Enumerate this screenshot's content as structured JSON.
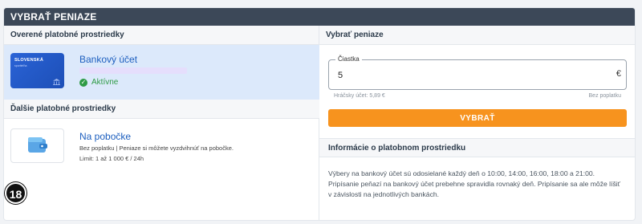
{
  "header": {
    "title": "VYBRAŤ PENIAZE"
  },
  "left": {
    "verified_title": "Overené platobné prostriedky",
    "bank_method": {
      "card_brand": "SLOVENSKÁ",
      "card_sub": "sporiteľňa",
      "title": "Bankový účet",
      "status": "Aktívne"
    },
    "other_title": "Ďalšie platobné prostriedky",
    "branch_method": {
      "title": "Na pobočke",
      "desc": "Bez poplatku | Peniaze si môžete vyzdvihnúť na pobočke.",
      "limit": "Limit: 1 až 1 000 € / 24h"
    },
    "age_badge": "18"
  },
  "right": {
    "title": "Vybrať peniaze",
    "amount": {
      "label": "Čiastka",
      "value": "5",
      "currency": "€"
    },
    "player_account": "Hráčsky účet: 5,89 €",
    "fee": "Bez poplatku",
    "withdraw_button": "VYBRAŤ",
    "info_title": "Informácie o platobnom prostriedku",
    "info_text": "Výbery na bankový účet sú odosielané každý deň o 10:00, 14:00, 16:00, 18:00 a 21:00. Pripísanie peňazí na bankový účet prebehne spravidla rovnaký deň. Pripísanie sa ale môže líšiť v závislosti na jednotlivých bankách."
  },
  "colors": {
    "header_bg": "#3c4858",
    "accent_orange": "#f7931e",
    "link_blue": "#1d5fbf",
    "active_green": "#2e9b45",
    "selected_bg": "#dce9fb"
  }
}
